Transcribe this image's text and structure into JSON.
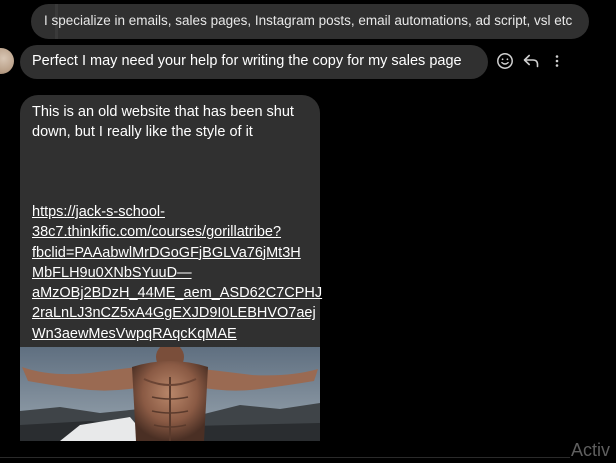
{
  "chat": {
    "reply_quote": "I specialize in emails, sales pages, Instagram posts, email automations, ad script, vsl etc",
    "message_1": "Perfect I may need your help for writing the copy for my sales page",
    "message_2_text": "This is an old website that has been shut down, but I really like the style of it",
    "message_2_link_lines": [
      "https://jack-s-school-",
      "38c7.thinkific.com/courses/gorillatribe?",
      "fbclid=PAAabwlMrDGoGFjBGLVa76jMt3H",
      "MbFLH9u0XNbSYuuD—",
      "aMzOBj2BDzH_44ME_aem_ASD62C7CPHJ",
      "2raLnLJ3nCZ5xA4GgEXJD9I0LEBHVO7aej",
      "Wn3aewMesVwpqRAqcKqMAE"
    ],
    "action_icons": [
      "smiley-icon",
      "reply-icon",
      "more-options-icon"
    ]
  },
  "overlay": {
    "watermark": "Activ"
  },
  "colors": {
    "background": "#000000",
    "bubble": "#303030",
    "text": "#ffffff"
  }
}
